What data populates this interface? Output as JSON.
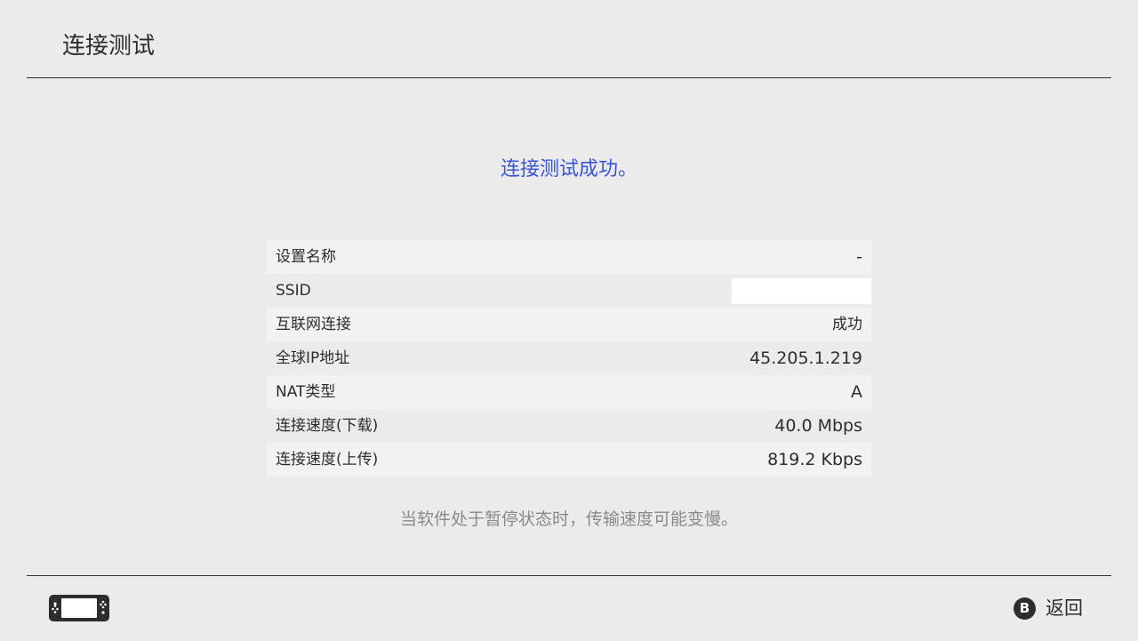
{
  "header": {
    "title": "连接测试"
  },
  "result": {
    "message": "连接测试成功。"
  },
  "info": {
    "rows": [
      {
        "label": "设置名称",
        "value": "-"
      },
      {
        "label": "SSID",
        "value": ""
      },
      {
        "label": "互联网连接",
        "value": "成功"
      },
      {
        "label": "全球IP地址",
        "value": "45.205.1.219"
      },
      {
        "label": "NAT类型",
        "value": "A"
      },
      {
        "label": "连接速度(下载)",
        "value": "40.0 Mbps"
      },
      {
        "label": "连接速度(上传)",
        "value": "819.2 Kbps"
      }
    ]
  },
  "note": "当软件处于暂停状态时，传输速度可能变慢。",
  "footer": {
    "console_icon": "handheld-console-icon",
    "back_button_glyph": "B",
    "back_label": "返回"
  },
  "colors": {
    "background": "#ebebeb",
    "accent": "#3b55d6",
    "text": "#2d2d2d",
    "muted_text": "#8a8a8a",
    "row_shade": "#f2f2f2"
  }
}
